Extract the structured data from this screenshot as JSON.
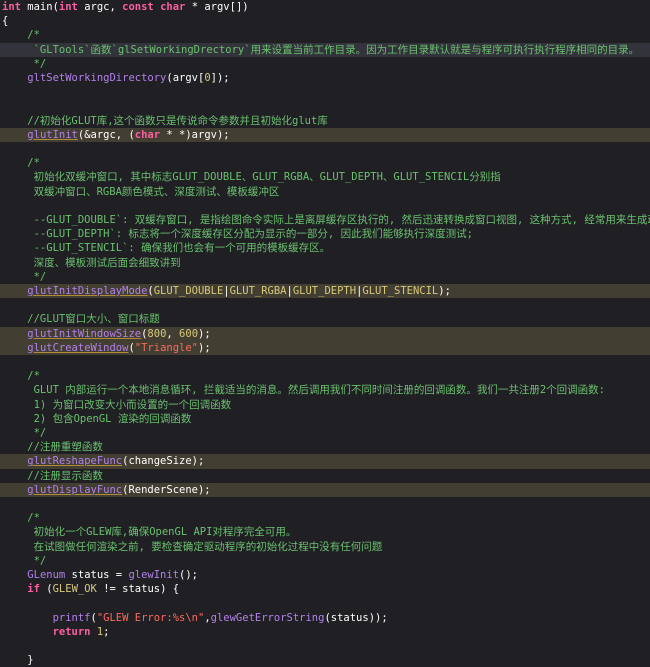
{
  "lines": [
    {
      "y": 0,
      "hl": "",
      "tokens": [
        {
          "t": "int",
          "c": "k"
        },
        {
          "t": " main(",
          "c": "p"
        },
        {
          "t": "int",
          "c": "k"
        },
        {
          "t": " argc, ",
          "c": "p"
        },
        {
          "t": "const",
          "c": "k"
        },
        {
          "t": " ",
          "c": "p"
        },
        {
          "t": "char",
          "c": "k"
        },
        {
          "t": " * argv[])",
          "c": "p"
        }
      ]
    },
    {
      "y": 1,
      "hl": "",
      "tokens": [
        {
          "t": "{",
          "c": "p"
        }
      ]
    },
    {
      "y": 2,
      "hl": "",
      "tokens": [
        {
          "t": "    /*",
          "c": "c"
        }
      ]
    },
    {
      "y": 3,
      "hl": "hl-light",
      "tokens": [
        {
          "t": "     `GLTools`函数`glSetWorkingDrectory`用来设置当前工作目录。因为工作目录默认就是与程序可执行执行程序相同的目录。",
          "c": "c"
        }
      ]
    },
    {
      "y": 4,
      "hl": "",
      "tokens": [
        {
          "t": "     */",
          "c": "c"
        }
      ]
    },
    {
      "y": 5,
      "hl": "",
      "tokens": [
        {
          "t": "    ",
          "c": "p"
        },
        {
          "t": "gltSetWorkingDirectory",
          "c": "f"
        },
        {
          "t": "(argv[",
          "c": "p"
        },
        {
          "t": "0",
          "c": "n"
        },
        {
          "t": "]);",
          "c": "p"
        }
      ]
    },
    {
      "y": 6,
      "hl": "",
      "tokens": []
    },
    {
      "y": 7,
      "hl": "",
      "tokens": []
    },
    {
      "y": 8,
      "hl": "",
      "tokens": [
        {
          "t": "    //初始化GLUT库,这个函数只是传说命令参数并且初始化glut库",
          "c": "c"
        }
      ]
    },
    {
      "y": 9,
      "hl": "hl",
      "tokens": [
        {
          "t": "    ",
          "c": "p"
        },
        {
          "t": "glutInit",
          "c": "fs"
        },
        {
          "t": "(&argc, (",
          "c": "p"
        },
        {
          "t": "char",
          "c": "k"
        },
        {
          "t": " * *)argv);",
          "c": "p"
        }
      ]
    },
    {
      "y": 10,
      "hl": "",
      "tokens": []
    },
    {
      "y": 11,
      "hl": "",
      "tokens": [
        {
          "t": "    /*",
          "c": "c"
        }
      ]
    },
    {
      "y": 12,
      "hl": "",
      "tokens": [
        {
          "t": "     初始化双缓冲窗口, 其中标志GLUT_DOUBLE、GLUT_RGBA、GLUT_DEPTH、GLUT_STENCIL分别指",
          "c": "c"
        }
      ]
    },
    {
      "y": 13,
      "hl": "",
      "tokens": [
        {
          "t": "     双缓冲窗口、RGBA颜色模式、深度测试、模板缓冲区",
          "c": "c"
        }
      ]
    },
    {
      "y": 14,
      "hl": "",
      "tokens": []
    },
    {
      "y": 15,
      "hl": "",
      "tokens": [
        {
          "t": "     --GLUT_DOUBLE`: 双缓存窗口, 是指绘图命令实际上是离屏缓存区执行的, 然后迅速转换成窗口视图, 这种方式, 经常用来生成动画效果;",
          "c": "c"
        }
      ]
    },
    {
      "y": 16,
      "hl": "",
      "tokens": [
        {
          "t": "     --GLUT_DEPTH`: 标志将一个深度缓存区分配为显示的一部分, 因此我们能够执行深度测试;",
          "c": "c"
        }
      ]
    },
    {
      "y": 17,
      "hl": "",
      "tokens": [
        {
          "t": "     --GLUT_STENCIL`: 确保我们也会有一个可用的模板缓存区。",
          "c": "c"
        }
      ]
    },
    {
      "y": 18,
      "hl": "",
      "tokens": [
        {
          "t": "     深度、模板测试后面会细致讲到",
          "c": "c"
        }
      ]
    },
    {
      "y": 19,
      "hl": "",
      "tokens": [
        {
          "t": "     */",
          "c": "c"
        }
      ]
    },
    {
      "y": 20,
      "hl": "hl",
      "tokens": [
        {
          "t": "    ",
          "c": "p"
        },
        {
          "t": "glutInitDisplayMode",
          "c": "fs"
        },
        {
          "t": "(",
          "c": "p"
        },
        {
          "t": "GLUT_DOUBLE",
          "c": "m"
        },
        {
          "t": "|",
          "c": "p"
        },
        {
          "t": "GLUT_RGBA",
          "c": "m"
        },
        {
          "t": "|",
          "c": "p"
        },
        {
          "t": "GLUT_DEPTH",
          "c": "m"
        },
        {
          "t": "|",
          "c": "p"
        },
        {
          "t": "GLUT_STENCIL",
          "c": "m"
        },
        {
          "t": ");",
          "c": "p"
        }
      ]
    },
    {
      "y": 21,
      "hl": "",
      "tokens": []
    },
    {
      "y": 22,
      "hl": "",
      "tokens": [
        {
          "t": "    //GLUT窗口大小、窗口标题",
          "c": "c"
        }
      ]
    },
    {
      "y": 23,
      "hl": "hl",
      "tokens": [
        {
          "t": "    ",
          "c": "p"
        },
        {
          "t": "glutInitWindowSize",
          "c": "fs"
        },
        {
          "t": "(",
          "c": "p"
        },
        {
          "t": "800",
          "c": "n"
        },
        {
          "t": ", ",
          "c": "p"
        },
        {
          "t": "600",
          "c": "n"
        },
        {
          "t": ");",
          "c": "p"
        }
      ]
    },
    {
      "y": 24,
      "hl": "hl",
      "tokens": [
        {
          "t": "    ",
          "c": "p"
        },
        {
          "t": "glutCreateWindow",
          "c": "fs"
        },
        {
          "t": "(",
          "c": "p"
        },
        {
          "t": "\"Triangle\"",
          "c": "s"
        },
        {
          "t": ");",
          "c": "p"
        }
      ]
    },
    {
      "y": 25,
      "hl": "",
      "tokens": []
    },
    {
      "y": 26,
      "hl": "",
      "tokens": [
        {
          "t": "    /*",
          "c": "c"
        }
      ]
    },
    {
      "y": 27,
      "hl": "",
      "tokens": [
        {
          "t": "     GLUT 内部运行一个本地消息循环, 拦截适当的消息。然后调用我们不同时间注册的回调函数。我们一共注册2个回调函数:",
          "c": "c"
        }
      ]
    },
    {
      "y": 28,
      "hl": "",
      "tokens": [
        {
          "t": "     1) 为窗口改变大小而设置的一个回调函数",
          "c": "c"
        }
      ]
    },
    {
      "y": 29,
      "hl": "",
      "tokens": [
        {
          "t": "     2) 包含OpenGL 渲染的回调函数",
          "c": "c"
        }
      ]
    },
    {
      "y": 30,
      "hl": "",
      "tokens": [
        {
          "t": "     */",
          "c": "c"
        }
      ]
    },
    {
      "y": 31,
      "hl": "",
      "tokens": [
        {
          "t": "    //注册重塑函数",
          "c": "c"
        }
      ]
    },
    {
      "y": 32,
      "hl": "hl",
      "tokens": [
        {
          "t": "    ",
          "c": "p"
        },
        {
          "t": "glutReshapeFunc",
          "c": "fs"
        },
        {
          "t": "(changeSize);",
          "c": "p"
        }
      ]
    },
    {
      "y": 33,
      "hl": "",
      "tokens": [
        {
          "t": "    //注册显示函数",
          "c": "c"
        }
      ]
    },
    {
      "y": 34,
      "hl": "hl",
      "tokens": [
        {
          "t": "    ",
          "c": "p"
        },
        {
          "t": "glutDisplayFunc",
          "c": "fs"
        },
        {
          "t": "(RenderScene);",
          "c": "p"
        }
      ]
    },
    {
      "y": 35,
      "hl": "",
      "tokens": []
    },
    {
      "y": 36,
      "hl": "",
      "tokens": [
        {
          "t": "    /*",
          "c": "c"
        }
      ]
    },
    {
      "y": 37,
      "hl": "",
      "tokens": [
        {
          "t": "     初始化一个GLEW库,确保OpenGL API对程序完全可用。",
          "c": "c"
        }
      ]
    },
    {
      "y": 38,
      "hl": "",
      "tokens": [
        {
          "t": "     在试图做任何渲染之前, 要检查确定驱动程序的初始化过程中没有任何问题",
          "c": "c"
        }
      ]
    },
    {
      "y": 39,
      "hl": "",
      "tokens": [
        {
          "t": "     */",
          "c": "c"
        }
      ]
    },
    {
      "y": 40,
      "hl": "",
      "tokens": [
        {
          "t": "    ",
          "c": "p"
        },
        {
          "t": "GLenum",
          "c": "f"
        },
        {
          "t": " status = ",
          "c": "p"
        },
        {
          "t": "glewInit",
          "c": "f"
        },
        {
          "t": "();",
          "c": "p"
        }
      ]
    },
    {
      "y": 41,
      "hl": "",
      "tokens": [
        {
          "t": "    ",
          "c": "p"
        },
        {
          "t": "if",
          "c": "k"
        },
        {
          "t": " (",
          "c": "p"
        },
        {
          "t": "GLEW_OK",
          "c": "m"
        },
        {
          "t": " != status) {",
          "c": "p"
        }
      ]
    },
    {
      "y": 42,
      "hl": "",
      "tokens": []
    },
    {
      "y": 43,
      "hl": "",
      "tokens": [
        {
          "t": "        ",
          "c": "p"
        },
        {
          "t": "printf",
          "c": "f"
        },
        {
          "t": "(",
          "c": "p"
        },
        {
          "t": "\"GLEW Error:%s\\n\"",
          "c": "s"
        },
        {
          "t": ",",
          "c": "p"
        },
        {
          "t": "glewGetErrorString",
          "c": "f"
        },
        {
          "t": "(status));",
          "c": "p"
        }
      ]
    },
    {
      "y": 44,
      "hl": "",
      "tokens": [
        {
          "t": "        ",
          "c": "p"
        },
        {
          "t": "return",
          "c": "k"
        },
        {
          "t": " ",
          "c": "p"
        },
        {
          "t": "1",
          "c": "n"
        },
        {
          "t": ";",
          "c": "p"
        }
      ]
    },
    {
      "y": 45,
      "hl": "",
      "tokens": []
    },
    {
      "y": 46,
      "hl": "",
      "tokens": [
        {
          "t": "    }",
          "c": "p"
        }
      ]
    }
  ]
}
